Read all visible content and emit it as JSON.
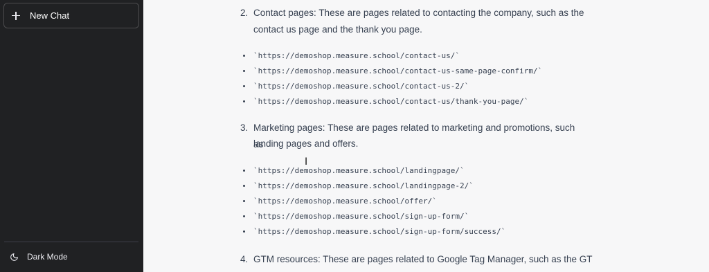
{
  "sidebar": {
    "new_chat_label": "New Chat",
    "dark_mode_label": "Dark Mode"
  },
  "main": {
    "sections": [
      {
        "number": "2.",
        "text_line1": "Contact pages: These are pages related to contacting the company, such as the",
        "text_line2": "contact us page and the thank you page.",
        "urls": [
          "`https://demoshop.measure.school/contact-us/`",
          "`https://demoshop.measure.school/contact-us-same-page-confirm/`",
          "`https://demoshop.measure.school/contact-us-2/`",
          "`https://demoshop.measure.school/contact-us/thank-you-page/`"
        ]
      },
      {
        "number": "3.",
        "text_line1": "Marketing pages: These are pages related to marketing and promotions, such as",
        "text_line2": "landing pages and offers.",
        "urls": [
          "`https://demoshop.measure.school/landingpage/`",
          "`https://demoshop.measure.school/landingpage-2/`",
          "`https://demoshop.measure.school/offer/`",
          "`https://demoshop.measure.school/sign-up-form/`",
          "`https://demoshop.measure.school/sign-up-form/success/`"
        ]
      },
      {
        "number": "4.",
        "text_line1": "GTM resources: These are pages related to Google Tag Manager, such as the GT"
      }
    ]
  }
}
